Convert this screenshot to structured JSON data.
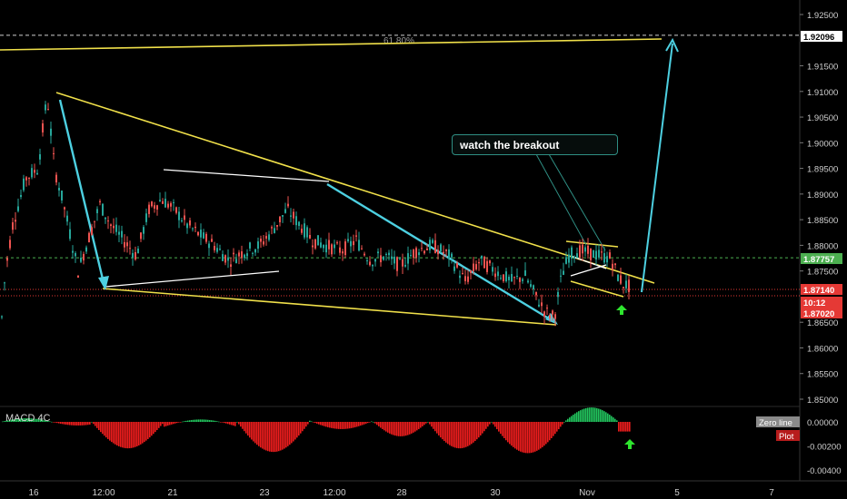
{
  "chart_data": {
    "type": "candlestick",
    "price_axis": {
      "ylim": [
        1.8475,
        1.925
      ],
      "ticks": [
        "1.92500",
        "1.91500",
        "1.91000",
        "1.90500",
        "1.90000",
        "1.89500",
        "1.89000",
        "1.88500",
        "1.88000",
        "1.87500",
        "1.86500",
        "1.86000",
        "1.85500",
        "1.85000"
      ]
    },
    "time_axis": [
      "16",
      "12:00",
      "21",
      "23",
      "12:00",
      "28",
      "30",
      "Nov",
      "5",
      "7"
    ],
    "price_badges": [
      {
        "text": "1.92096",
        "value": 1.92096,
        "color": "#ffffff",
        "bg": "#ffffff",
        "fg": "#000000"
      },
      {
        "text": "1.87757",
        "value": 1.87757,
        "color": "#4caf50",
        "bg": "#4caf50",
        "fg": "#ffffff"
      },
      {
        "text": "1.87140",
        "value": 1.8714,
        "color": "#e53935",
        "bg": "#e53935",
        "fg": "#ffffff"
      },
      {
        "text": "10:12",
        "value": 1.8701,
        "color": "#e53935",
        "bg": "#e53935",
        "fg": "#ffffff"
      },
      {
        "text": "1.87020",
        "value": 1.8685,
        "color": "#e53935",
        "bg": "#e53935",
        "fg": "#ffffff"
      }
    ],
    "fib_label": "61.80%",
    "annotation": "watch the breakout",
    "indicator": {
      "name": "MACD 4C",
      "ylim": [
        -0.0045,
        0.0008
      ],
      "ticks": [
        "0.00000",
        "-0.00200",
        "-0.00400"
      ],
      "badges": [
        {
          "text": "Zero line",
          "bg": "#8a8a8a",
          "fg": "#ffffff"
        },
        {
          "text": "Plot",
          "bg": "#b71c1c",
          "fg": "#ffffff"
        }
      ]
    },
    "colors": {
      "up": "#26a69a",
      "down": "#ef5350",
      "bull": "#4caf50",
      "trend": "#f0e04a",
      "arrow": "#4dd0e1",
      "wedge": "#ffffff"
    }
  }
}
